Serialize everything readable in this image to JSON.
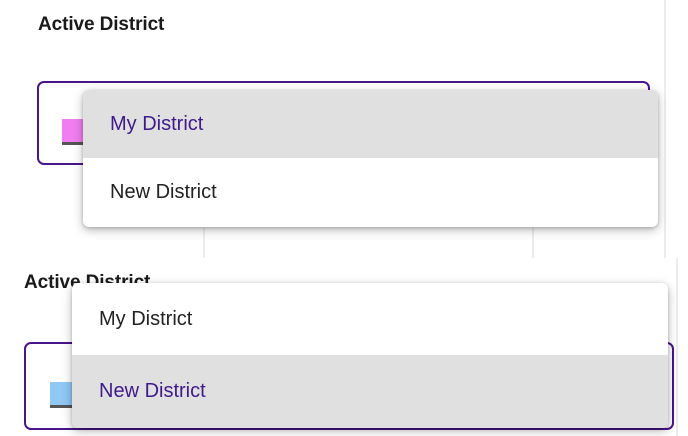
{
  "panel_top": {
    "section_title": "Active District",
    "swatch_color": "#f07ef0",
    "accent_color": "#4a148c",
    "menu": {
      "items": [
        {
          "label": "My District",
          "selected": true
        },
        {
          "label": "New District",
          "selected": false
        }
      ]
    }
  },
  "panel_bottom": {
    "section_title": "Active District",
    "swatch_color": "#90c8f4",
    "accent_color": "#4a148c",
    "menu": {
      "items": [
        {
          "label": "My District",
          "selected": false
        },
        {
          "label": "New District",
          "selected": true
        }
      ]
    }
  }
}
